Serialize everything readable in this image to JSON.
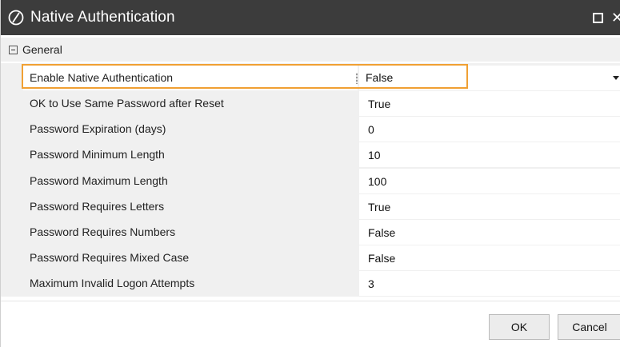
{
  "window": {
    "title": "Native Authentication",
    "app_icon": "slash-circle-icon",
    "controls": [
      "maximize-icon",
      "close-icon"
    ]
  },
  "group": {
    "label": "General",
    "toggle_icon": "collapse-minus-icon"
  },
  "properties": [
    {
      "name": "Enable Native Authentication",
      "value": "False",
      "selected": true,
      "editor": "dropdown"
    },
    {
      "name": "OK to Use Same Password after Reset",
      "value": "True"
    },
    {
      "name": "Password Expiration (days)",
      "value": "0"
    },
    {
      "name": "Password Minimum Length",
      "value": "10"
    },
    {
      "name": "Password Maximum Length",
      "value": "100"
    },
    {
      "name": "Password Requires Letters",
      "value": "True"
    },
    {
      "name": "Password Requires Numbers",
      "value": "False"
    },
    {
      "name": "Password Requires Mixed Case",
      "value": "False"
    },
    {
      "name": "Maximum Invalid Logon Attempts",
      "value": "3"
    }
  ],
  "buttons": {
    "ok": "OK",
    "cancel": "Cancel"
  },
  "colors": {
    "titlebar": "#3c3c3c",
    "highlight": "#f0a033",
    "grid_background": "#f0f0f0"
  }
}
